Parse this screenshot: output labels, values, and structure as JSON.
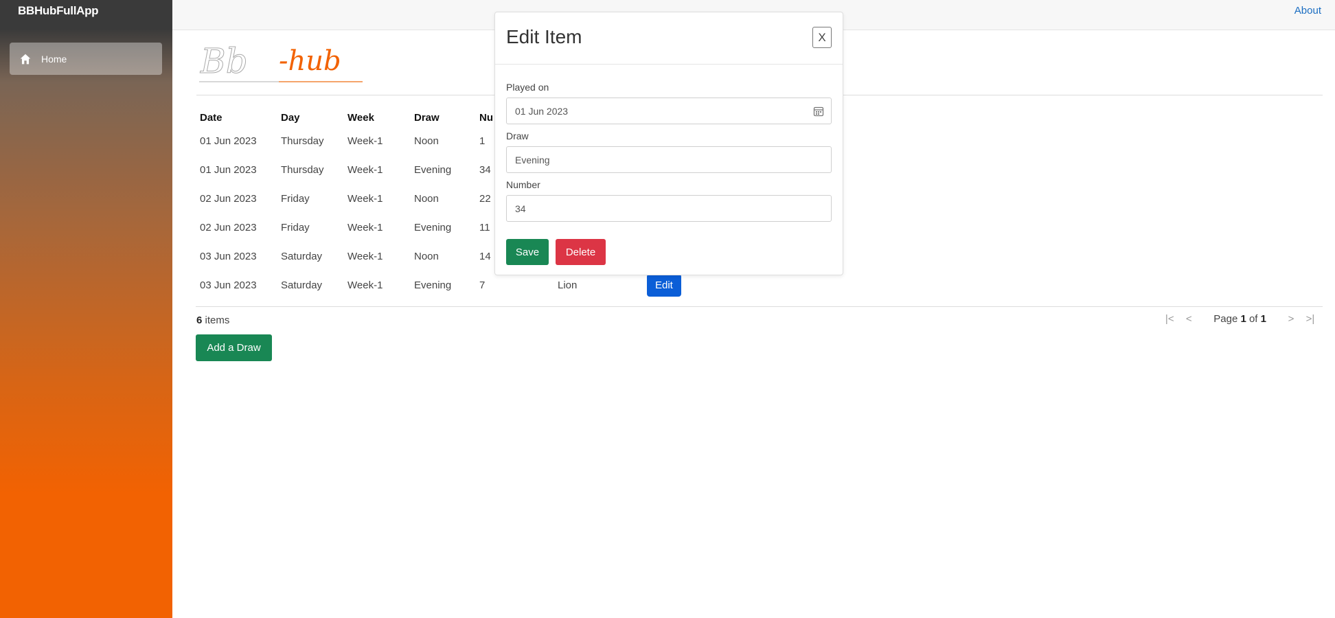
{
  "app": {
    "title": "BBHubFullApp"
  },
  "sidebar": {
    "items": [
      {
        "label": "Home",
        "icon": "home-icon"
      }
    ]
  },
  "header": {
    "about_label": "About"
  },
  "logo": {
    "text_left": "Bb",
    "text_right": "-hub",
    "accent": "#f26202"
  },
  "grid": {
    "headers": [
      "Date",
      "Day",
      "Week",
      "Draw",
      "Nu"
    ],
    "rows": [
      {
        "date": "01 Jun 2023",
        "day": "Thursday",
        "week": "Week-1",
        "draw": "Noon",
        "number": "1",
        "extra": ""
      },
      {
        "date": "01 Jun 2023",
        "day": "Thursday",
        "week": "Week-1",
        "draw": "Evening",
        "number": "34",
        "extra": ""
      },
      {
        "date": "02 Jun 2023",
        "day": "Friday",
        "week": "Week-1",
        "draw": "Noon",
        "number": "22",
        "extra": ""
      },
      {
        "date": "02 Jun 2023",
        "day": "Friday",
        "week": "Week-1",
        "draw": "Evening",
        "number": "11",
        "extra": ""
      },
      {
        "date": "03 Jun 2023",
        "day": "Saturday",
        "week": "Week-1",
        "draw": "Noon",
        "number": "14",
        "extra": ""
      },
      {
        "date": "03 Jun 2023",
        "day": "Saturday",
        "week": "Week-1",
        "draw": "Evening",
        "number": "7",
        "extra": "Lion",
        "edit_label": "Edit"
      }
    ],
    "items_count": "6",
    "items_suffix": " items",
    "pager": {
      "first": "|<",
      "prev": "<",
      "next": ">",
      "last": ">|",
      "page_prefix": "Page ",
      "page": "1",
      "of": " of ",
      "total": "1"
    },
    "add_label": "Add a Draw"
  },
  "modal": {
    "title": "Edit Item",
    "close_label": "X",
    "played_on_label": "Played on",
    "played_on_value": "01 Jun 2023",
    "draw_label": "Draw",
    "draw_value": "Evening",
    "number_label": "Number",
    "number_value": "34",
    "save_label": "Save",
    "delete_label": "Delete"
  },
  "colors": {
    "primary": "#0b5ed7",
    "success": "#198754",
    "danger": "#dc3545",
    "sidebar_bottom": "#f26202",
    "link": "#1b6ec2"
  }
}
